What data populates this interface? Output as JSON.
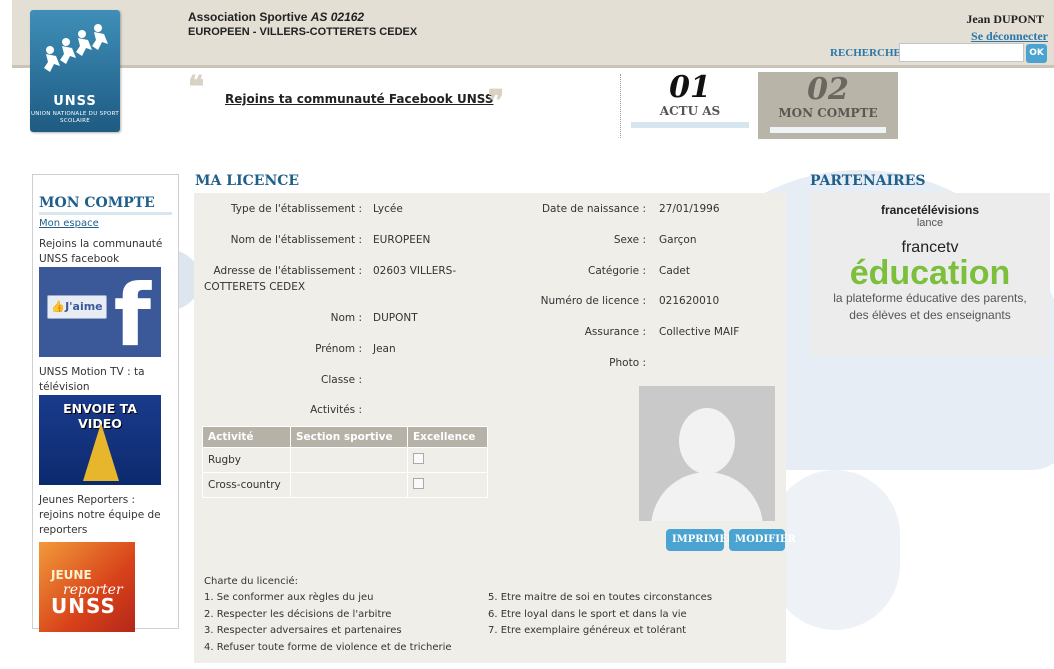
{
  "header": {
    "logo_brand": "UNSS",
    "logo_sub": "UNION NATIONALE DU SPORT SCOLAIRE",
    "assoc_prefix": "Association Sportive",
    "assoc_code": "AS 02162",
    "assoc_line2": "EUROPEEN - VILLERS-COTTERETS CEDEX",
    "user_name": "Jean DUPONT",
    "logout_label": "Se déconnecter",
    "search_label": "RECHERCHE",
    "search_value": "",
    "search_button": "OK"
  },
  "banner": {
    "fb_link": "Rejoins ta communauté Facebook UNSS"
  },
  "nav": {
    "tabs": [
      {
        "num": "01",
        "label": "ACTU AS"
      },
      {
        "num": "02",
        "label": "MON COMPTE"
      }
    ]
  },
  "sidebar": {
    "title": "MON COMPTE",
    "link_mon_espace": "Mon espace",
    "blocks": [
      {
        "text": "Rejoins la communauté UNSS facebook",
        "img_label": "J'aime",
        "img_letter": "f"
      },
      {
        "text": "UNSS Motion TV : ta télévision",
        "img_label": "ENVOIE TA VIDEO"
      },
      {
        "text": "Jeunes Reporters : rejoins notre équipe de reporters",
        "img_t1": "JEUNE",
        "img_t2": "reporter",
        "img_t3": "UNSS"
      }
    ]
  },
  "main": {
    "title": "MA LICENCE",
    "fields_left": [
      {
        "label": "Type de l'établissement :",
        "value": "Lycée"
      },
      {
        "label": "Nom de l'établissement :",
        "value": "EUROPEEN"
      },
      {
        "label": "Adresse de l'établissement :",
        "value": "02603 VILLERS-",
        "value2": "COTTERETS CEDEX"
      },
      {
        "label": "Nom :",
        "value": "DUPONT"
      },
      {
        "label": "Prénom :",
        "value": "Jean"
      },
      {
        "label": "Classe :",
        "value": ""
      },
      {
        "label": "Activités :",
        "value": ""
      }
    ],
    "fields_right": [
      {
        "label": "Date de naissance :",
        "value": "27/01/1996"
      },
      {
        "label": "Sexe :",
        "value": "Garçon"
      },
      {
        "label": "Catégorie :",
        "value": "Cadet"
      },
      {
        "label": "Numéro de licence :",
        "value": "021620010"
      },
      {
        "label": "Assurance :",
        "value": "Collective MAIF"
      },
      {
        "label": "Photo :",
        "value": ""
      }
    ],
    "activities_table": {
      "headers": [
        "Activité",
        "Section sportive",
        "Excellence"
      ],
      "rows": [
        {
          "activite": "Rugby",
          "section": "",
          "excellence": false
        },
        {
          "activite": "Cross-country",
          "section": "",
          "excellence": false
        }
      ]
    },
    "buttons": {
      "print": "IMPRIMER",
      "edit": "MODIFIER"
    },
    "charte_title": "Charte du licencié:",
    "charte_col1": [
      "1. Se conformer aux règles du jeu",
      "2. Respecter les décisions de l'arbitre",
      "3. Respecter adversaires et partenaires",
      "4. Refuser toute forme de violence et de tricherie"
    ],
    "charte_col2": [
      "5. Etre maitre de soi en toutes circonstances",
      "6. Etre loyal dans le sport et dans la vie",
      "7. Etre exemplaire généreux et tolérant"
    ]
  },
  "partners": {
    "title": "PARTENAIRES",
    "ft": "francetélévisions",
    "lance": "lance",
    "ftv": "francetv",
    "edu": "éducation",
    "desc_line1": "la plateforme éducative des parents,",
    "desc_line2": "des élèves et des enseignants"
  },
  "colors": {
    "accent_blue": "#1f5f8b",
    "button_blue": "#4aa3d1",
    "header_beige": "#e3dfd4",
    "panel_bg": "#f0eee9",
    "tab_active": "#b9b4a8",
    "edu_green": "#7bbf3b"
  }
}
